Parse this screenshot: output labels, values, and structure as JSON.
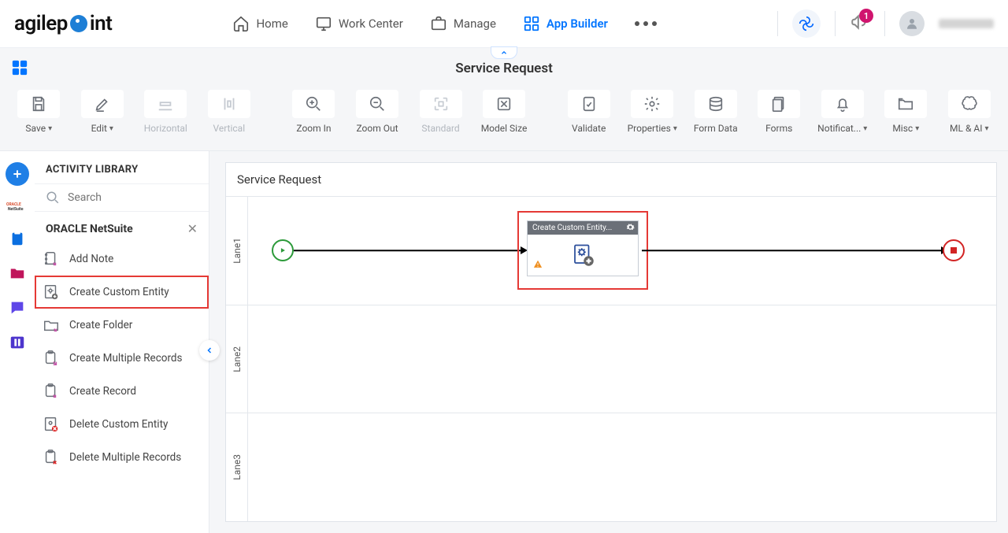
{
  "header": {
    "logo_pre": "agilep",
    "logo_post": "int",
    "nav": {
      "home": "Home",
      "work_center": "Work Center",
      "manage": "Manage",
      "app_builder": "App Builder"
    },
    "notification_count": "1"
  },
  "title": "Service Request",
  "toolbar": {
    "save": "Save",
    "edit": "Edit",
    "horizontal": "Horizontal",
    "vertical": "Vertical",
    "zoom_in": "Zoom In",
    "zoom_out": "Zoom Out",
    "standard": "Standard",
    "model_size": "Model Size",
    "validate": "Validate",
    "properties": "Properties",
    "form_data": "Form Data",
    "forms": "Forms",
    "notifications": "Notificat...",
    "misc": "Misc",
    "ml_ai": "ML & AI"
  },
  "sidebar": {
    "title": "ACTIVITY LIBRARY",
    "search_placeholder": "Search",
    "category": "ORACLE NetSuite",
    "items": [
      {
        "label": "Add Note"
      },
      {
        "label": "Create Custom Entity"
      },
      {
        "label": "Create Folder"
      },
      {
        "label": "Create Multiple Records"
      },
      {
        "label": "Create Record"
      },
      {
        "label": "Delete Custom Entity"
      },
      {
        "label": "Delete Multiple Records"
      }
    ]
  },
  "canvas": {
    "title": "Service Request",
    "lanes": [
      "Lane1",
      "Lane2",
      "Lane3"
    ],
    "task_label": "Create Custom Entity..."
  }
}
